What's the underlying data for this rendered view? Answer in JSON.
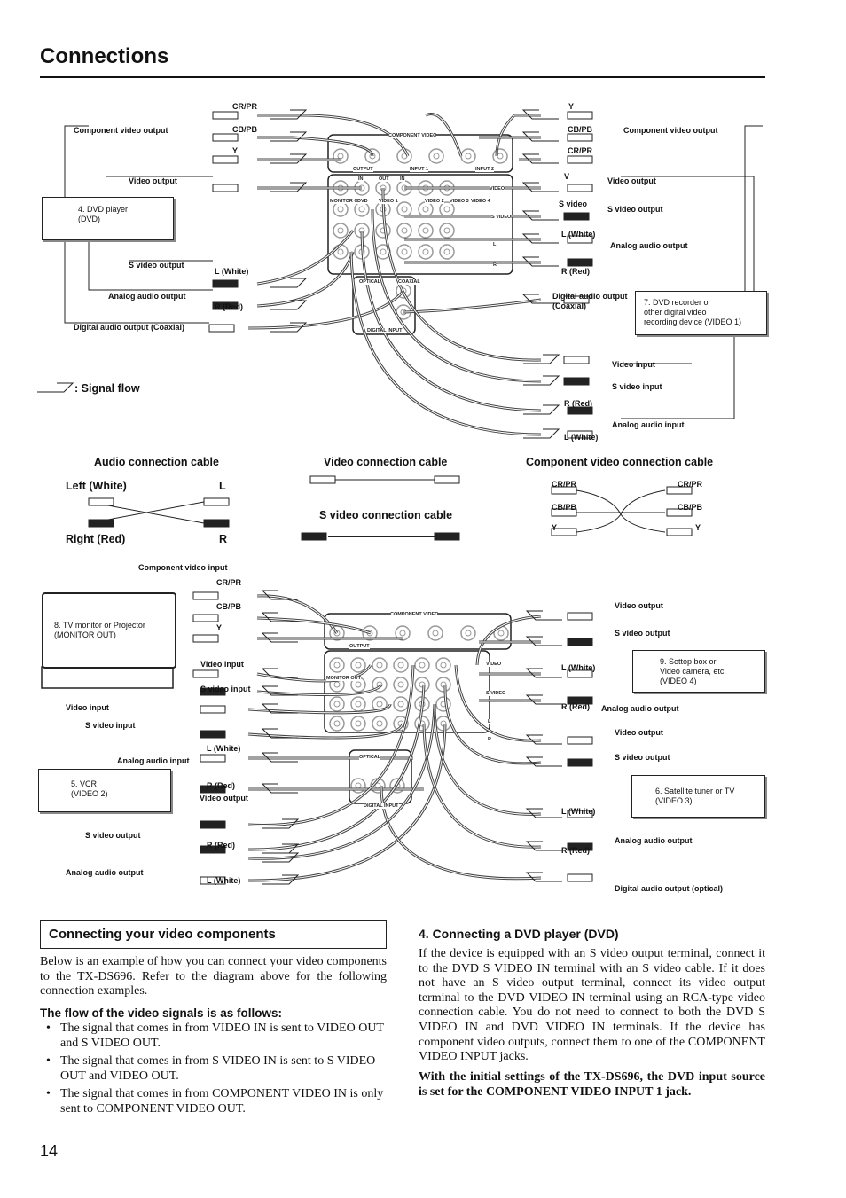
{
  "title": "Connections",
  "legend": {
    "signal_flow": ": Signal flow"
  },
  "devices": {
    "dvd": "4. DVD player\n(DVD)",
    "dvd_recorder": "7. DVD recorder or\n   other digital video\n   recording device (VIDEO 1)",
    "tv": "8. TV monitor or Projector\n    (MONITOR OUT)",
    "vcr": "5. VCR\n    (VIDEO 2)",
    "settop": "9. Settop box or\n    Video camera, etc.\n    (VIDEO 4)",
    "satellite": "6. Satellite tuner or TV\n    (VIDEO 3)"
  },
  "receiver": {
    "component_video": "COMPONENT VIDEO",
    "output": "OUTPUT",
    "input1": "INPUT 1",
    "input2": "INPUT 2",
    "video": "VIDEO",
    "s_video": "S VIDEO",
    "l": "L",
    "r": "R",
    "dvd": "DVD",
    "video1": "VIDEO 1",
    "video2": "VIDEO 2",
    "video3": "VIDEO 3",
    "video4": "VIDEO 4",
    "in": "IN",
    "out": "OUT",
    "monitor_out": "MONITOR OUT",
    "coaxial": "COAXIAL",
    "optical": "OPTICAL",
    "digital_input": "DIGITAL INPUT"
  },
  "cables": {
    "audio": "Audio connection cable",
    "video": "Video connection cable",
    "component": "Component video connection cable",
    "s_video": "S video connection cable",
    "left_white": "Left (White)",
    "right_red": "Right (Red)",
    "l": "L",
    "r": "R"
  },
  "labels": [
    "CR/PR",
    "CB/PB",
    "Y",
    "Component video output",
    "Video output",
    "S video output",
    "L (White)",
    "Analog audio output",
    "R (Red)",
    "Digital audio output (Coaxial)",
    "Y",
    "CB/PB",
    "Component video output",
    "CR/PR",
    "V",
    "Video output",
    "S video",
    "S video output",
    "L (White)",
    "Analog audio output",
    "R (Red)",
    "Digital audio output\n(Coaxial)",
    "Video input",
    "S video input",
    "R (Red)",
    "Analog audio input",
    "L (White)",
    "CR/PR",
    "CB/PB",
    "Y",
    "CR/PR",
    "CB/PB",
    "Y",
    "Component video input",
    "CR/PR",
    "CB/PB",
    "Y",
    "Video input",
    "S video input",
    "Video input",
    "S video input",
    "L (White)",
    "Analog audio input",
    "R (Red)",
    "Video output",
    "S video output",
    "R (Red)",
    "Analog audio output",
    "L (White)",
    "Video output",
    "S video output",
    "L (White)",
    "R (Red)",
    "Analog audio output",
    "Video output",
    "S video output",
    "L (White)",
    "Analog audio output",
    "R (Red)",
    "Digital audio output (optical)"
  ],
  "section": {
    "heading": "Connecting your video components",
    "intro": "Below is an example of how you can connect your video components to the TX-DS696. Refer to the diagram above for the following connection examples.",
    "flow_heading": "The flow of the video signals is as follows:",
    "bullets": [
      "The signal that comes in from VIDEO IN is sent to VIDEO OUT and S VIDEO OUT.",
      "The signal that comes in from S VIDEO IN is sent to S VIDEO OUT and VIDEO OUT.",
      "The signal that comes in from COMPONENT VIDEO IN is only sent to COMPONENT VIDEO OUT."
    ],
    "dvd_heading": "4.  Connecting a DVD player (DVD)",
    "dvd_text": "If the device is equipped with an S video output terminal, connect it to the DVD S VIDEO IN terminal with an S video cable. If it does not have an S video output terminal, connect its video output terminal to the DVD VIDEO IN terminal using an RCA-type video connection cable. You do not need to connect to both the DVD S VIDEO IN and DVD VIDEO IN terminals. If the device has component video outputs, connect them to one of the COMPONENT VIDEO INPUT jacks.",
    "dvd_note": "With the initial settings of the TX-DS696, the DVD input source is set for the COMPONENT VIDEO INPUT 1 jack."
  },
  "page_number": "14"
}
